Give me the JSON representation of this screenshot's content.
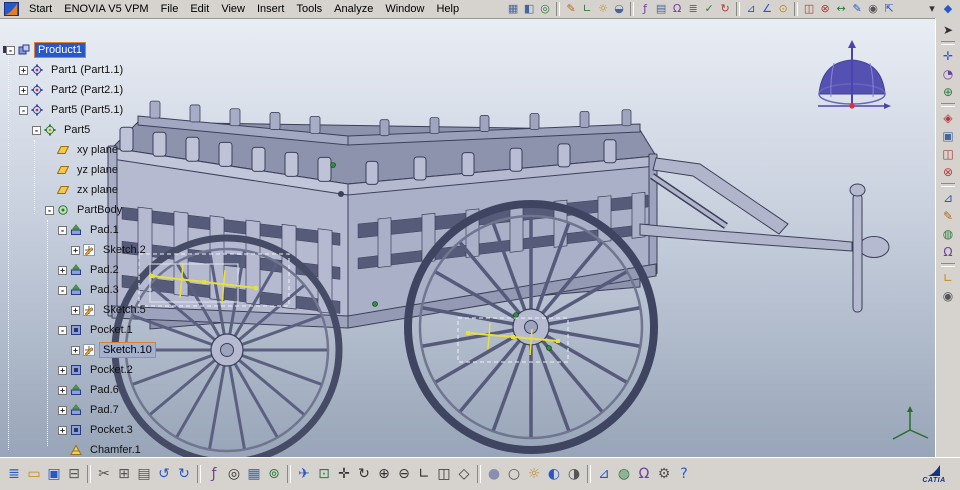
{
  "app": {
    "name": "CATIA V5",
    "logo_text": "CATIA"
  },
  "menu_bar": {
    "items": [
      {
        "label": "Start"
      },
      {
        "label": "ENOVIA V5 VPM"
      },
      {
        "label": "File"
      },
      {
        "label": "Edit"
      },
      {
        "label": "View"
      },
      {
        "label": "Insert"
      },
      {
        "label": "Tools"
      },
      {
        "label": "Analyze"
      },
      {
        "label": "Window"
      },
      {
        "label": "Help"
      }
    ]
  },
  "top_toolbar": {
    "icons": [
      {
        "name": "visualization-filter",
        "glyph": "▦",
        "color": "#46659f"
      },
      {
        "name": "render-style",
        "glyph": "◧",
        "color": "#46659f"
      },
      {
        "name": "magnifier",
        "glyph": "◎",
        "color": "#2f7a3f"
      },
      {
        "sep": true
      },
      {
        "name": "paint",
        "glyph": "✎",
        "color": "#b06a20"
      },
      {
        "name": "ruler",
        "glyph": "∟",
        "color": "#2f7a3f"
      },
      {
        "name": "light-source",
        "glyph": "☼",
        "color": "#c08a20"
      },
      {
        "name": "depth-effect",
        "glyph": "◒",
        "color": "#46659f"
      },
      {
        "sep": true
      },
      {
        "name": "formula",
        "glyph": "ƒ",
        "color": "#6f3fa0"
      },
      {
        "name": "design-table",
        "glyph": "▤",
        "color": "#46659f"
      },
      {
        "name": "knowledge",
        "glyph": "Ω",
        "color": "#6f3fa0"
      },
      {
        "name": "rule-editor",
        "glyph": "≣",
        "color": "#2f7a3f"
      },
      {
        "name": "check-editor",
        "glyph": "✓",
        "color": "#2f7a3f"
      },
      {
        "name": "reaction",
        "glyph": "↻",
        "color": "#b03a3a"
      },
      {
        "sep": true
      },
      {
        "name": "measure-between",
        "glyph": "⊿",
        "color": "#2858c8"
      },
      {
        "name": "measure-item",
        "glyph": "∠",
        "color": "#2858c8"
      },
      {
        "name": "mass-properties",
        "glyph": "⊙",
        "color": "#c08a20"
      },
      {
        "sep": true
      },
      {
        "name": "sectioning",
        "glyph": "◫",
        "color": "#b03a3a"
      },
      {
        "name": "clash",
        "glyph": "⊗",
        "color": "#b03a3a"
      },
      {
        "name": "distance-band",
        "glyph": "↔",
        "color": "#2f7a3f"
      },
      {
        "name": "annotation-3d",
        "glyph": "✎",
        "color": "#2858c8"
      },
      {
        "name": "camera-capture",
        "glyph": "◉",
        "color": "#555555"
      },
      {
        "name": "publish",
        "glyph": "⇱",
        "color": "#2858c8"
      }
    ],
    "tail_icons": [
      {
        "name": "window-list",
        "glyph": "▾",
        "color": "#333333"
      },
      {
        "name": "workbench",
        "glyph": "◆",
        "color": "#2858c8"
      }
    ]
  },
  "tree": {
    "items": [
      {
        "label": "Product1",
        "level": 0,
        "icon": "product",
        "expander": "-",
        "selected": "primary"
      },
      {
        "label": "Part1 (Part1.1)",
        "level": 1,
        "icon": "part",
        "expander": "+"
      },
      {
        "label": "Part2 (Part2.1)",
        "level": 1,
        "icon": "part",
        "expander": "+"
      },
      {
        "label": "Part5 (Part5.1)",
        "level": 1,
        "icon": "part",
        "expander": "-"
      },
      {
        "label": "Part5",
        "level": 2,
        "icon": "part-active",
        "expander": "-"
      },
      {
        "label": "xy plane",
        "level": 3,
        "icon": "plane"
      },
      {
        "label": "yz plane",
        "level": 3,
        "icon": "plane"
      },
      {
        "label": "zx plane",
        "level": 3,
        "icon": "plane"
      },
      {
        "label": "PartBody",
        "level": 3,
        "icon": "partbody",
        "expander": "-"
      },
      {
        "label": "Pad.1",
        "level": 4,
        "icon": "pad",
        "expander": "-"
      },
      {
        "label": "Sketch.2",
        "level": 5,
        "icon": "sketch",
        "expander": "+"
      },
      {
        "label": "Pad.2",
        "level": 4,
        "icon": "pad",
        "expander": "+"
      },
      {
        "label": "Pad.3",
        "level": 4,
        "icon": "pad",
        "expander": "-"
      },
      {
        "label": "Sketch.5",
        "level": 5,
        "icon": "sketch",
        "expander": "+"
      },
      {
        "label": "Pocket.1",
        "level": 4,
        "icon": "pocket",
        "expander": "-"
      },
      {
        "label": "Sketch.10",
        "level": 5,
        "icon": "sketch",
        "expander": "+",
        "selected": "secondary"
      },
      {
        "label": "Pocket.2",
        "level": 4,
        "icon": "pocket",
        "expander": "+"
      },
      {
        "label": "Pad.6",
        "level": 4,
        "icon": "pad",
        "expander": "+"
      },
      {
        "label": "Pad.7",
        "level": 4,
        "icon": "pad",
        "expander": "+"
      },
      {
        "label": "Pocket.3",
        "level": 4,
        "icon": "pocket",
        "expander": "+"
      },
      {
        "label": "Chamfer.1",
        "level": 4,
        "icon": "chamfer"
      }
    ]
  },
  "right_toolbar": {
    "icons": [
      {
        "name": "select-arrow",
        "glyph": "➤",
        "color": "#333333"
      },
      {
        "sep": true
      },
      {
        "name": "move",
        "glyph": "✛",
        "color": "#2858c8"
      },
      {
        "name": "compass-manipulation",
        "glyph": "◔",
        "color": "#6f3fa0"
      },
      {
        "name": "snap",
        "glyph": "⊕",
        "color": "#2f7a3f"
      },
      {
        "sep": true
      },
      {
        "name": "space-analysis",
        "glyph": "◈",
        "color": "#b03a3a"
      },
      {
        "name": "scene",
        "glyph": "▣",
        "color": "#46659f"
      },
      {
        "name": "section-view",
        "glyph": "◫",
        "color": "#b03a3a"
      },
      {
        "name": "clash-analysis",
        "glyph": "⊗",
        "color": "#b03a3a"
      },
      {
        "sep": true
      },
      {
        "name": "measure",
        "glyph": "⊿",
        "color": "#2858c8"
      },
      {
        "name": "text-annotation",
        "glyph": "✎",
        "color": "#b06a20"
      },
      {
        "name": "catalog-browser",
        "glyph": "◍",
        "color": "#2f7a3f"
      },
      {
        "name": "knowledge-tools",
        "glyph": "Ω",
        "color": "#6f3fa0"
      },
      {
        "sep": true
      },
      {
        "name": "axis-system",
        "glyph": "∟",
        "color": "#c08a20"
      },
      {
        "name": "scene-capture",
        "glyph": "◉",
        "color": "#555555"
      }
    ]
  },
  "bottom_toolbar": {
    "icons": [
      {
        "name": "specification-tree-toggle",
        "glyph": "≣",
        "color": "#2858c8"
      },
      {
        "name": "open",
        "glyph": "▭",
        "color": "#c08a20"
      },
      {
        "name": "save",
        "glyph": "▣",
        "color": "#2858c8"
      },
      {
        "name": "print",
        "glyph": "⊟",
        "color": "#555555"
      },
      {
        "sep": true
      },
      {
        "name": "cut",
        "glyph": "✂",
        "color": "#555555"
      },
      {
        "name": "copy",
        "glyph": "⊞",
        "color": "#555555"
      },
      {
        "name": "paste",
        "glyph": "▤",
        "color": "#555555"
      },
      {
        "name": "undo",
        "glyph": "↺",
        "color": "#2858c8"
      },
      {
        "name": "redo",
        "glyph": "↻",
        "color": "#2858c8"
      },
      {
        "sep": true
      },
      {
        "name": "formula-fx",
        "glyph": "ƒ",
        "color": "#6f3fa0"
      },
      {
        "name": "search",
        "glyph": "◎",
        "color": "#333333"
      },
      {
        "name": "work-on-support",
        "glyph": "▦",
        "color": "#46659f"
      },
      {
        "name": "snap-to-point",
        "glyph": "⊚",
        "color": "#2f7a3f"
      },
      {
        "sep": true
      },
      {
        "name": "fly-mode",
        "glyph": "✈",
        "color": "#2858c8"
      },
      {
        "name": "fit-all-in",
        "glyph": "⊡",
        "color": "#2f7a3f"
      },
      {
        "name": "pan",
        "glyph": "✛",
        "color": "#333333"
      },
      {
        "name": "rotate",
        "glyph": "↻",
        "color": "#333333"
      },
      {
        "name": "zoom-in",
        "glyph": "⊕",
        "color": "#333333"
      },
      {
        "name": "zoom-out",
        "glyph": "⊖",
        "color": "#333333"
      },
      {
        "name": "normal-view",
        "glyph": "∟",
        "color": "#333333"
      },
      {
        "name": "create-multi-view",
        "glyph": "◫",
        "color": "#333333"
      },
      {
        "name": "isometric-view",
        "glyph": "◇",
        "color": "#333333"
      },
      {
        "sep": true
      },
      {
        "name": "shading-mode",
        "glyph": "●",
        "color": "#8a8fb0"
      },
      {
        "name": "wireframe-mode",
        "glyph": "○",
        "color": "#555555"
      },
      {
        "name": "lighting",
        "glyph": "☼",
        "color": "#c08a20"
      },
      {
        "name": "hide-show",
        "glyph": "◐",
        "color": "#2858c8"
      },
      {
        "name": "swap-visible-space",
        "glyph": "◑",
        "color": "#555555"
      },
      {
        "sep": true
      },
      {
        "name": "measure-between-b",
        "glyph": "⊿",
        "color": "#2858c8"
      },
      {
        "name": "catalog",
        "glyph": "◍",
        "color": "#2f7a3f"
      },
      {
        "name": "knowledge-b",
        "glyph": "Ω",
        "color": "#6f3fa0"
      },
      {
        "name": "options",
        "glyph": "⚙",
        "color": "#555555"
      },
      {
        "name": "whats-this",
        "glyph": "?",
        "color": "#2858c8"
      }
    ]
  },
  "selection": {
    "primary": "Product1",
    "secondary": "Sketch.10",
    "highlight_color": "#2858c8",
    "outline_color": "#e07f28"
  },
  "viewport_colors": {
    "background_top": "#e9edf4",
    "background_mid": "#c8d0de",
    "background_bottom": "#98a5b8",
    "model": "#b6bad1",
    "model_dark": "#8d92ad",
    "outline": "#3c3f58",
    "sketch_highlight": "#e8e03a",
    "compass": "#4a45ae"
  }
}
